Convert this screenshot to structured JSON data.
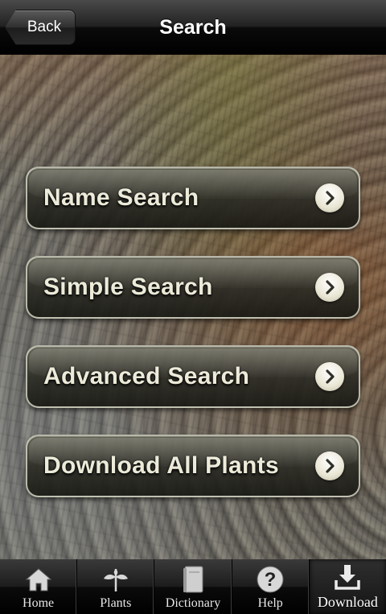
{
  "navbar": {
    "title": "Search",
    "back_label": "Back"
  },
  "menu": {
    "items": [
      {
        "label": "Name Search"
      },
      {
        "label": "Simple Search"
      },
      {
        "label": "Advanced Search"
      },
      {
        "label": "Download All Plants"
      }
    ]
  },
  "tabbar": {
    "tabs": [
      {
        "label": "Home",
        "icon": "home-icon"
      },
      {
        "label": "Plants",
        "icon": "plant-icon"
      },
      {
        "label": "Dictionary",
        "icon": "book-icon"
      },
      {
        "label": "Help",
        "icon": "help-icon"
      },
      {
        "label": "Download",
        "icon": "download-icon",
        "selected": true
      }
    ]
  },
  "colors": {
    "button_text": "#ecead8",
    "chevron_circle": "#e9e6d4",
    "bar_background": "#1c1c1c"
  }
}
